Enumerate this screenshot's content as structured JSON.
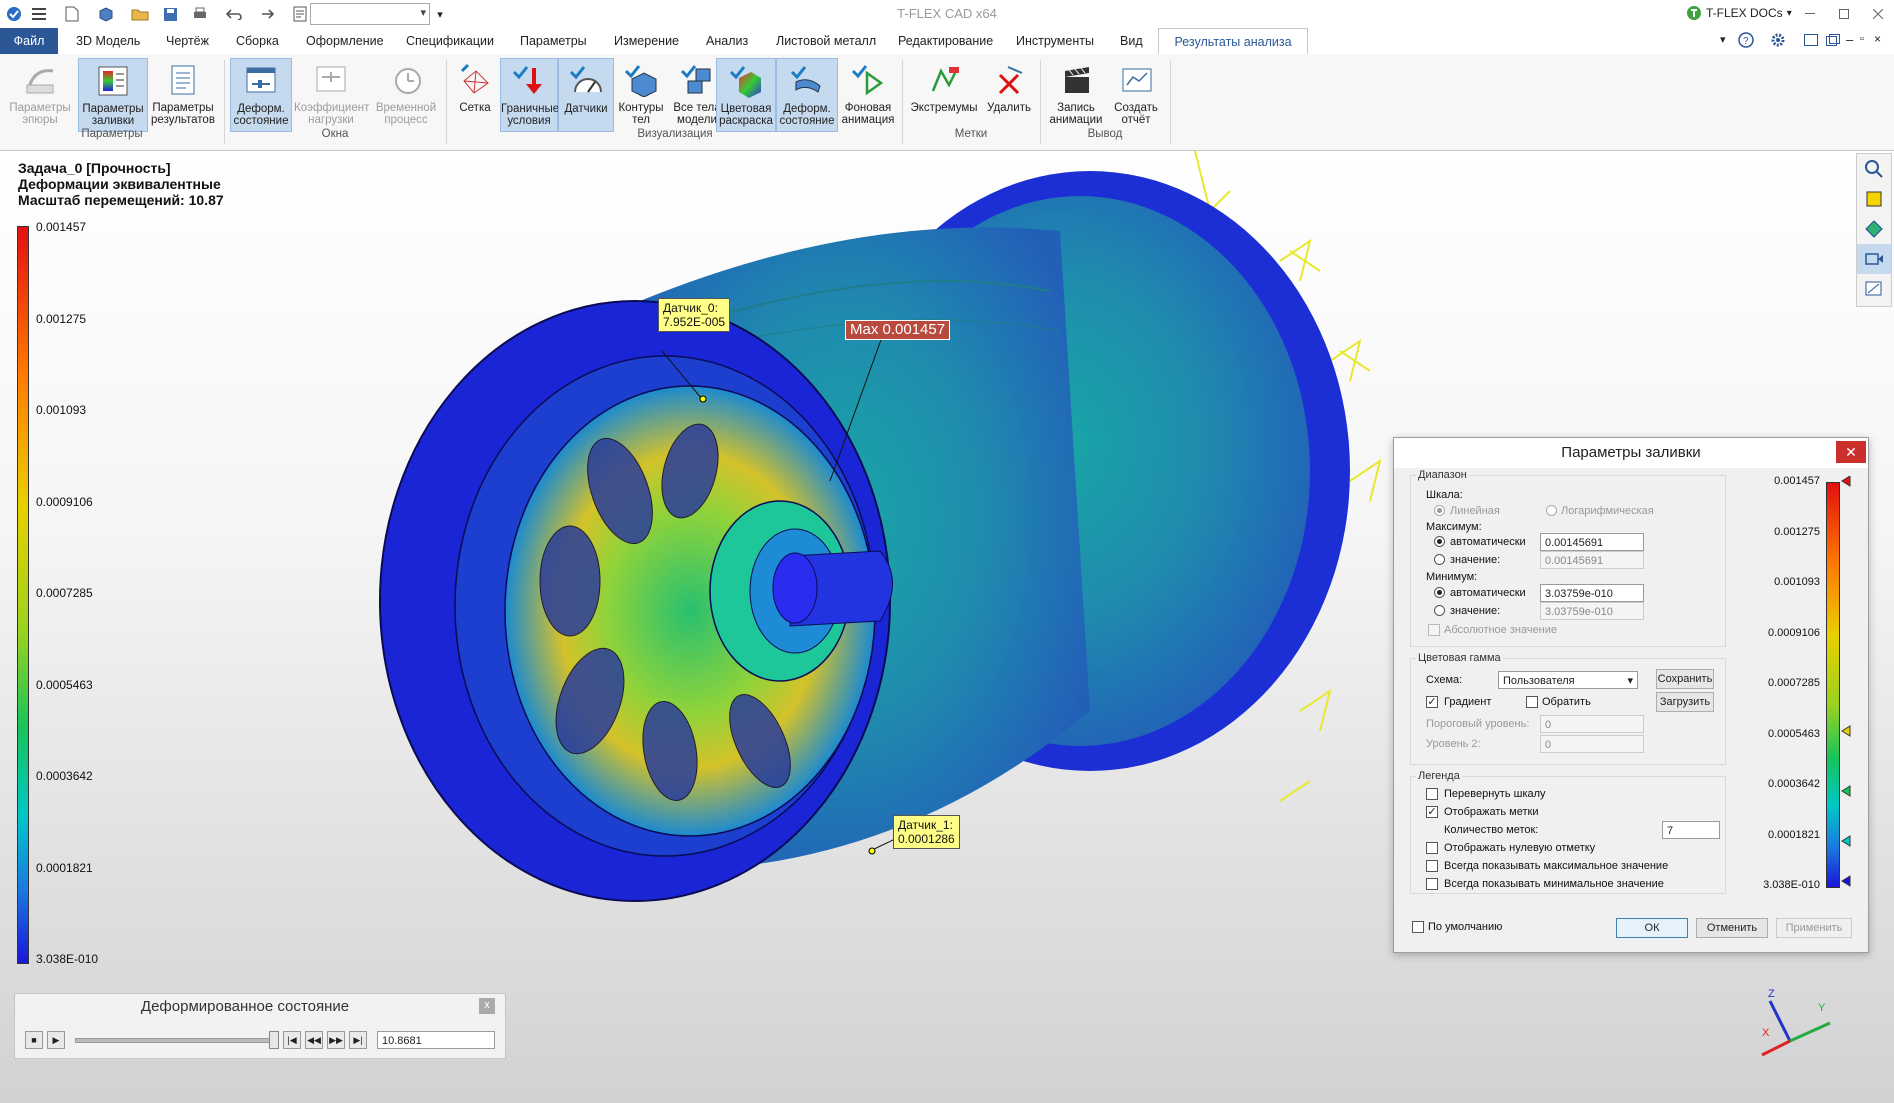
{
  "app": {
    "title": "T-FLEX CAD x64",
    "docs_label": "T-FLEX DOCs"
  },
  "menu": {
    "file": "Файл",
    "model3d": "3D Модель",
    "drawing": "Чертёж",
    "assembly": "Сборка",
    "design": "Оформление",
    "specs": "Спецификации",
    "params": "Параметры",
    "measure": "Измерение",
    "analysis": "Анализ",
    "sheet": "Листовой металл",
    "edit": "Редактирование",
    "tools": "Инструменты",
    "view": "Вид",
    "results": "Результаты анализа"
  },
  "ribbon": {
    "b_plot_params_1": "Параметры",
    "b_plot_params_2": "эпюры",
    "b_fill_params_1": "Параметры",
    "b_fill_params_2": "заливки",
    "b_result_params_1": "Параметры",
    "b_result_params_2": "результатов",
    "b_deform_1": "Деформ.",
    "b_deform_2": "состояние",
    "b_load_factor_1": "Коэффициент",
    "b_load_factor_2": "нагрузки",
    "b_time_process_1": "Временной",
    "b_time_process_2": "процесс",
    "b_mesh": "Сетка",
    "b_bc_1": "Граничные",
    "b_bc_2": "условия",
    "b_sensors": "Датчики",
    "b_contours_1": "Контуры",
    "b_contours_2": "тел",
    "b_all_bodies_1": "Все тела",
    "b_all_bodies_2": "модели",
    "b_color_fill_1": "Цветовая",
    "b_color_fill_2": "раскраска",
    "b_deform2_1": "Деформ.",
    "b_deform2_2": "состояние",
    "b_bg_anim_1": "Фоновая",
    "b_bg_anim_2": "анимация",
    "b_extremes": "Экстремумы",
    "b_delete": "Удалить",
    "b_record_1": "Запись",
    "b_record_2": "анимации",
    "b_report_1": "Создать",
    "b_report_2": "отчёт",
    "g_params": "Параметры",
    "g_windows": "Окна",
    "g_vis": "Визуализация",
    "g_marks": "Метки",
    "g_output": "Вывод"
  },
  "sim": {
    "task": "Задача_0 [Прочность]",
    "result": "Деформации эквивалентные",
    "scale": "Масштаб перемещений: 10.87"
  },
  "legend": [
    "0.001457",
    "0.001275",
    "0.001093",
    "0.0009106",
    "0.0007285",
    "0.0005463",
    "0.0003642",
    "0.0001821",
    "3.038E-010"
  ],
  "callouts": {
    "sensor0_name": "Датчик_0:",
    "sensor0_value": "7.952E-005",
    "sensor1_name": "Датчик_1:",
    "sensor1_value": "0.0001286",
    "max": "Max 0.001457"
  },
  "dialog": {
    "title": "Параметры заливки",
    "range": "Диапазон",
    "scale": "Шкала:",
    "linear": "Линейная",
    "log": "Логарифмическая",
    "maximum": "Максимум:",
    "auto": "автоматически",
    "value": "значение:",
    "max_auto_value": "0.00145691",
    "max_value": "0.00145691",
    "minimum": "Минимум:",
    "min_auto_value": "3.03759e-010",
    "min_value": "3.03759e-010",
    "abs_value": "Абсолютное значение",
    "color_gamut": "Цветовая гамма",
    "scheme": "Схема:",
    "scheme_value": "Пользователя",
    "save": "Сохранить",
    "load": "Загрузить",
    "gradient": "Градиент",
    "invert": "Обратить",
    "threshold": "Пороговый уровень:",
    "threshold_value": "0",
    "level2": "Уровень 2:",
    "level2_value": "0",
    "legend": "Легенда",
    "flip_scale": "Перевернуть шкалу",
    "show_marks": "Отображать метки",
    "marks_count": "Количество меток:",
    "marks_count_value": "7",
    "show_zero": "Отображать нулевую отметку",
    "always_max": "Всегда показывать максимальное значение",
    "always_min": "Всегда показывать минимальное значение",
    "default": "По умолчанию",
    "ok": "ОК",
    "cancel": "Отменить",
    "apply": "Применить",
    "legend_values": [
      "0.001457",
      "0.001275",
      "0.001093",
      "0.0009106",
      "0.0007285",
      "0.0005463",
      "0.0003642",
      "0.0001821",
      "3.038E-010"
    ]
  },
  "deform_panel": {
    "title": "Деформированное состояние",
    "close": "x",
    "value": "10.8681"
  },
  "triad": {
    "x": "X",
    "y": "Y",
    "z": "Z"
  }
}
